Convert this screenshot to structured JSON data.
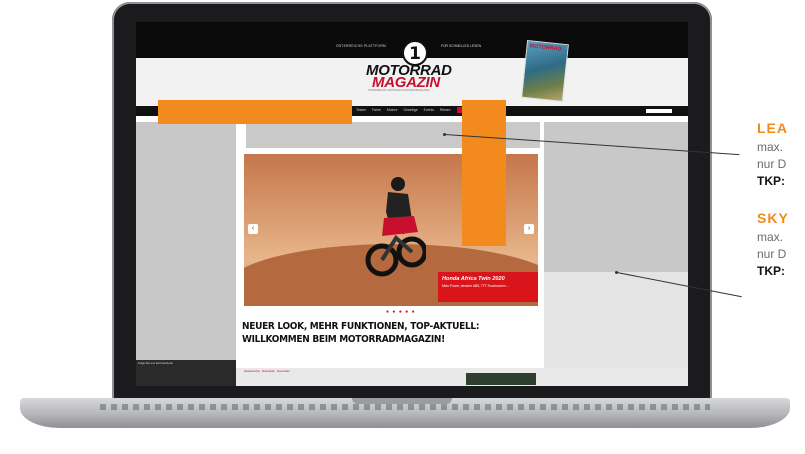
{
  "site": {
    "tagline_left": "ÖSTERREICHS PLATTFORM",
    "tagline_right": "FÜR SCHNELLES LESEN",
    "logo_number": "1",
    "logo_line1": "MOTORRAD",
    "logo_line2": "MAGAZIN",
    "logo_subline": "ÖSTERREICHS GRÖSSTES MOTORRADMAGAZIN",
    "magazine_badge": "MOTORRAD"
  },
  "nav": {
    "items": [
      "Home",
      "Testen",
      "Fahre",
      "Motore",
      "Gesellige",
      "Events",
      "Reisen"
    ],
    "search_placeholder": ""
  },
  "hero": {
    "caption_title": "Honda Africa Twin 2020",
    "caption_subtitle": "Mehr Power, bessere ABS, TFT-Touchscreen ...",
    "dots": "● ● ● ● ●"
  },
  "article": {
    "headline_line1": "NEUER LOOK, MEHR FUNKTIONEN, TOP-AKTUELL:",
    "headline_line2": "WILLKOMMEN BEIM MOTORRADMAGAZIN!"
  },
  "bottom": {
    "facebook_text": "Folge Sie uns auf Facebook",
    "strip_text": "Reiseberichte   ·   Motorräder   ·   Motorräder"
  },
  "callouts": {
    "leaderboard_title": "LEA",
    "leaderboard_line1": "max.",
    "leaderboard_line2": "nur D",
    "leaderboard_line3": "TKP:",
    "skyscraper_title": "SKY",
    "skyscraper_line1": "max.",
    "skyscraper_line2": "nur D",
    "skyscraper_line3": "TKP:"
  },
  "colors": {
    "accent": "#f28a1e",
    "brand_red": "#c8102e"
  }
}
